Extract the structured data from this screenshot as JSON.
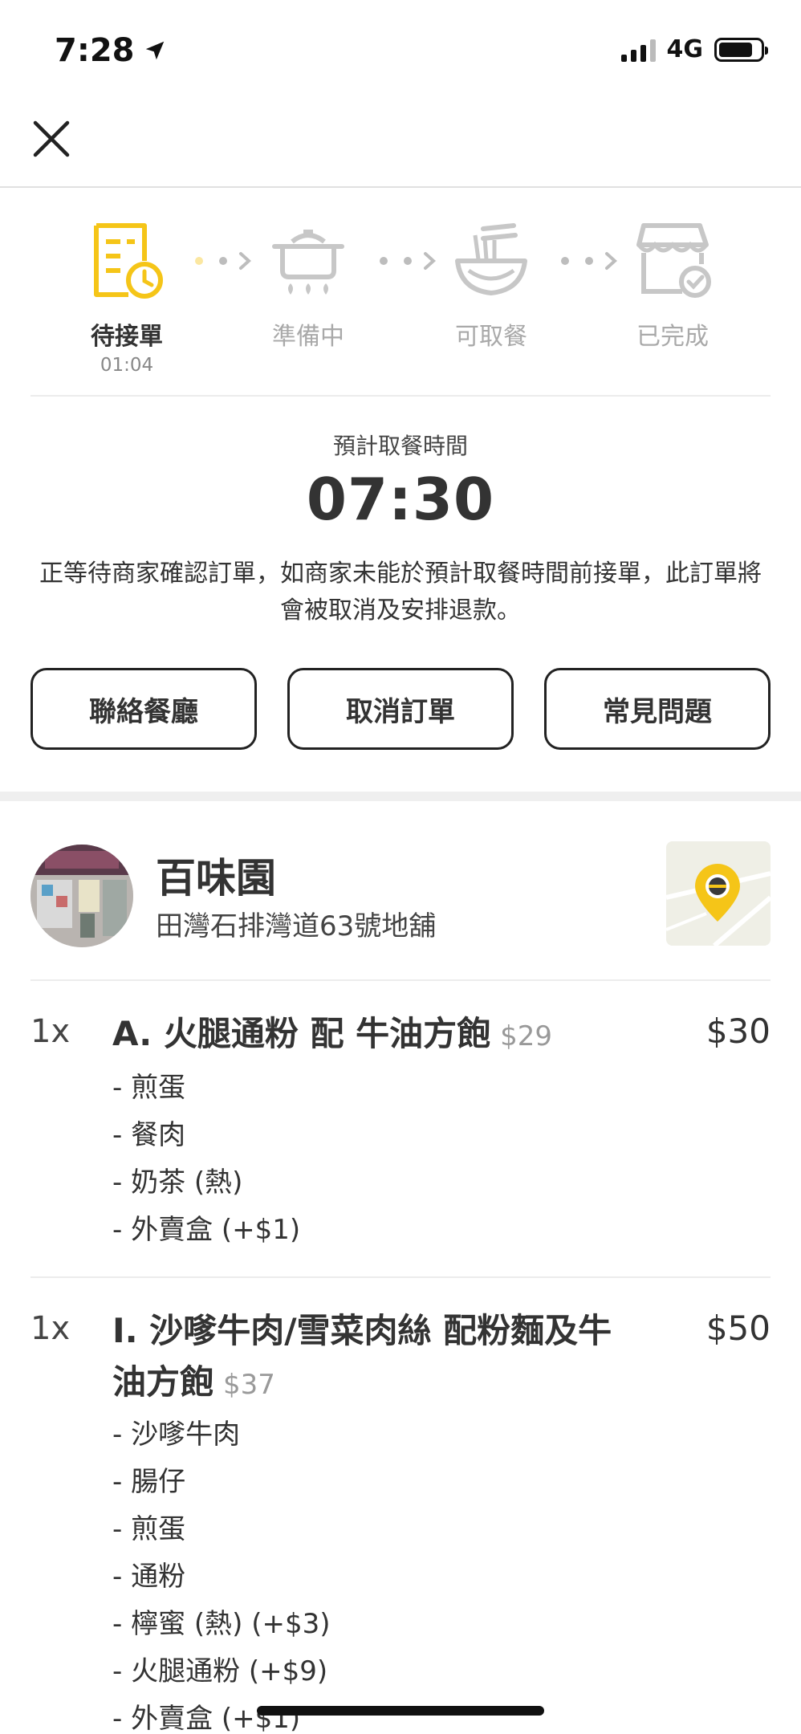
{
  "status_bar": {
    "time": "7:28",
    "network": "4G"
  },
  "steps": [
    {
      "label": "待接單",
      "sub": "01:04"
    },
    {
      "label": "準備中"
    },
    {
      "label": "可取餐"
    },
    {
      "label": "已完成"
    }
  ],
  "pickup": {
    "label": "預計取餐時間",
    "time": "07:30",
    "notice": "正等待商家確認訂單，如商家未能於預計取餐時間前接單，此訂單將會被取消及安排退款。"
  },
  "actions": {
    "contact": "聯絡餐廳",
    "cancel": "取消訂單",
    "faq": "常見問題"
  },
  "restaurant": {
    "name": "百味園",
    "address": "田灣石排灣道63號地舖"
  },
  "items": [
    {
      "qty": "1x",
      "name": "A. 火腿通粉 配 牛油方飽",
      "base_price": "$29",
      "price": "$30",
      "options": [
        "- 煎蛋",
        "- 餐肉",
        "- 奶茶 (熱)",
        "- 外賣盒 (+$1)"
      ]
    },
    {
      "qty": "1x",
      "name_line1": "I. 沙嗲牛肉/雪菜肉絲 配粉麵及牛",
      "name_line2": "油方飽",
      "base_price": "$37",
      "price": "$50",
      "options": [
        "- 沙嗲牛肉",
        "- 腸仔",
        "- 煎蛋",
        "- 通粉",
        "- 檸蜜 (熱) (+$3)",
        "- 火腿通粉 (+$9)",
        "- 外賣盒 (+$1)"
      ]
    }
  ],
  "colors": {
    "accent": "#F5C518",
    "inactive": "#BDBDBD"
  },
  "icons": {
    "close": "close-icon",
    "step1": "order-receipt-clock-icon",
    "step2": "cooking-pot-icon",
    "step3": "noodle-bowl-icon",
    "step4": "store-check-icon",
    "map": "map-pin-icon"
  }
}
